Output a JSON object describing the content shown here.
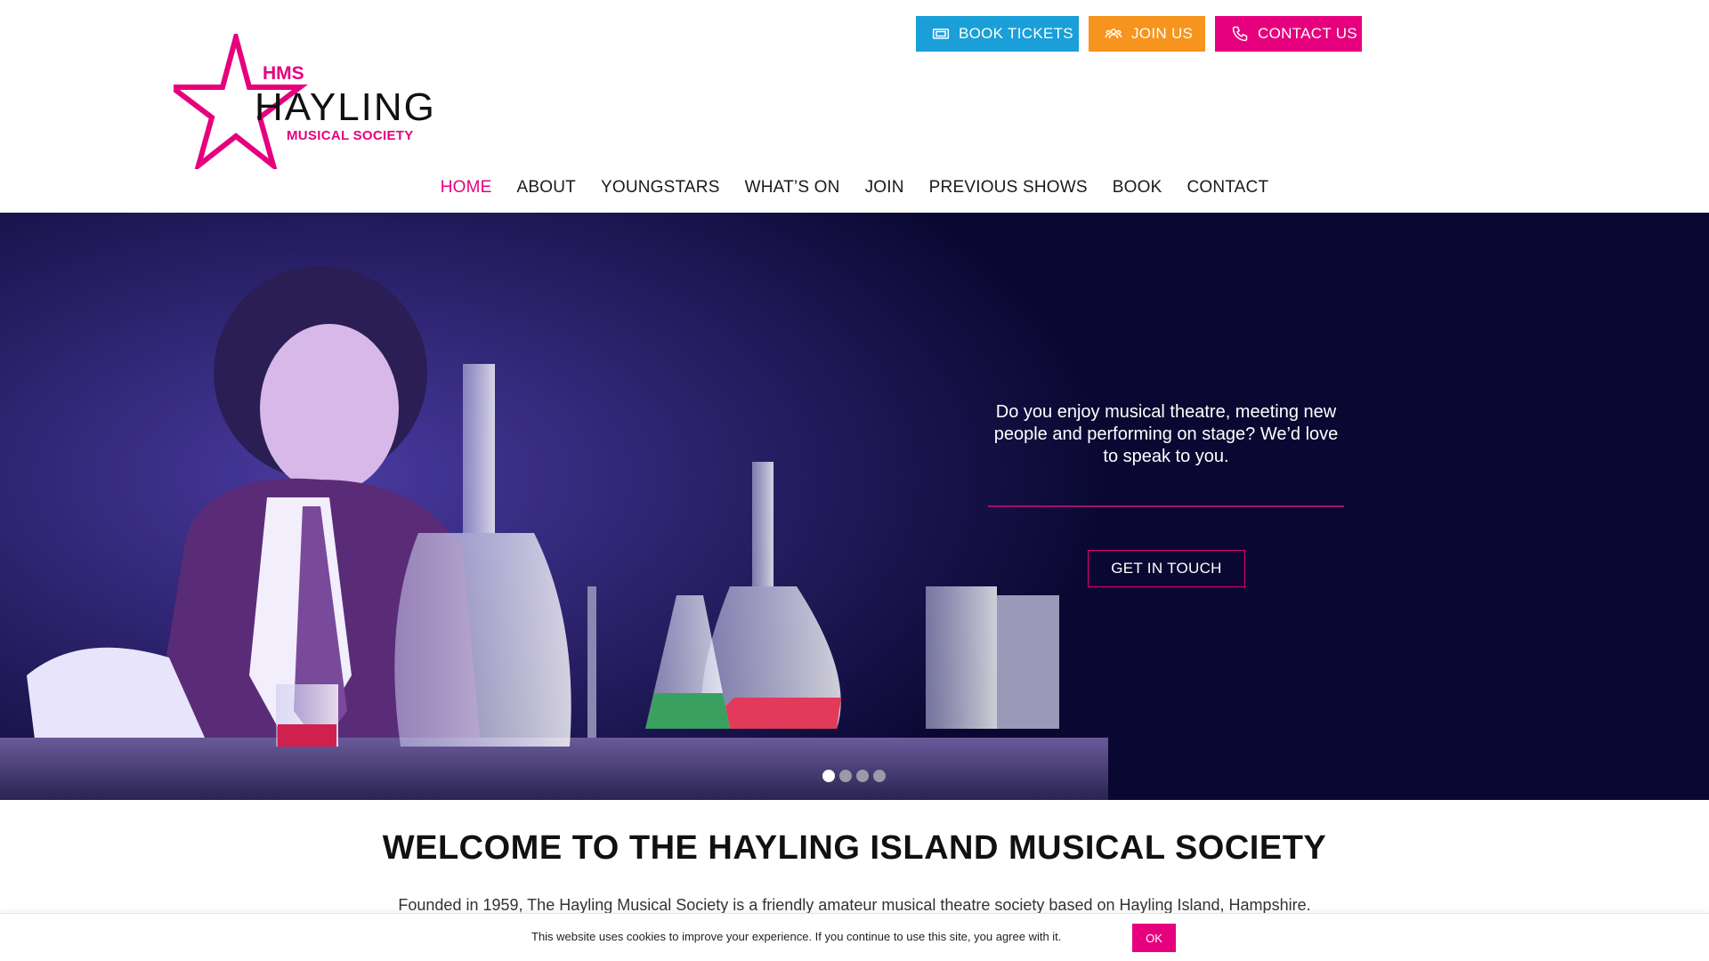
{
  "header": {
    "buttons": {
      "book_tickets": "BOOK TICKETS",
      "join_us": "JOIN US",
      "contact_us": "CONTACT US"
    },
    "logo": {
      "hms": "HMS",
      "hayling": "HAYLING",
      "society": "MUSICAL SOCIETY"
    },
    "nav": [
      "HOME",
      "ABOUT",
      "YOUNGSTARS",
      "WHAT’S ON",
      "JOIN",
      "PREVIOUS SHOWS",
      "BOOK",
      "CONTACT"
    ],
    "active_nav": "HOME"
  },
  "hero": {
    "text": "Do you enjoy musical theatre, meeting new people and performing on stage? We’d love to speak to you.",
    "cta": "GET IN TOUCH",
    "slides": 4,
    "active_slide": 1
  },
  "welcome": {
    "title": "WELCOME TO THE HAYLING ISLAND MUSICAL SOCIETY",
    "text": "Founded in 1959, The Hayling Musical Society is a friendly amateur musical theatre society based on Hayling Island, Hampshire."
  },
  "cookie": {
    "text": "This website uses cookies to improve your experience. If you continue to use this site, you agree with it.",
    "ok": "OK"
  },
  "colors": {
    "pink": "#e6007e",
    "blue": "#1a9fd8",
    "orange": "#f7941d",
    "hero_bg": "#0a0832"
  },
  "icons": [
    "ticket-icon",
    "users-icon",
    "phone-icon",
    "star-logo-icon"
  ]
}
